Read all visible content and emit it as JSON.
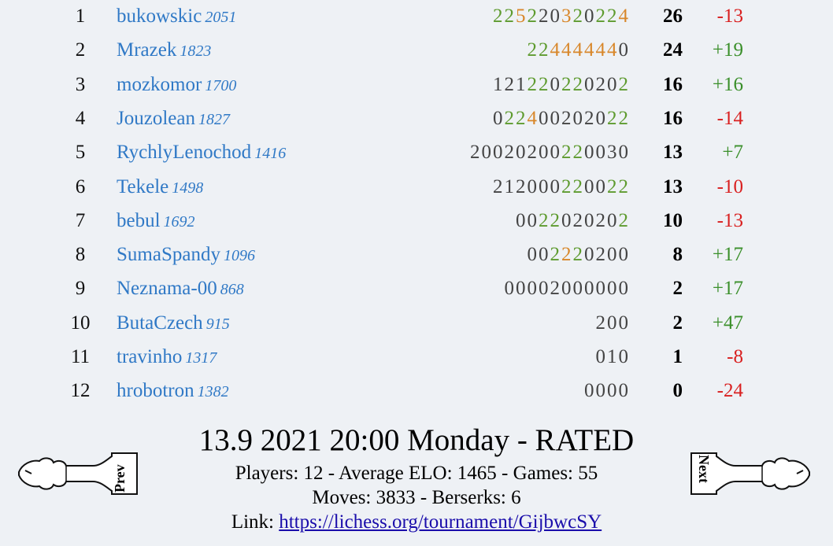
{
  "standings": [
    {
      "rank": "1",
      "name": "bukowskic",
      "elo": "2051",
      "scores": [
        {
          "t": "2",
          "c": "g"
        },
        {
          "t": "2",
          "c": "g"
        },
        {
          "t": "5",
          "c": "o"
        },
        {
          "t": "2",
          "c": "g"
        },
        {
          "t": "2",
          "c": "d"
        },
        {
          "t": "0",
          "c": "d"
        },
        {
          "t": "3",
          "c": "o"
        },
        {
          "t": "2",
          "c": "g"
        },
        {
          "t": "0",
          "c": "d"
        },
        {
          "t": "2",
          "c": "g"
        },
        {
          "t": "2",
          "c": "g"
        },
        {
          "t": "4",
          "c": "o"
        }
      ],
      "points": "26",
      "diff": "-13"
    },
    {
      "rank": "2",
      "name": "Mrazek",
      "elo": "1823",
      "scores": [
        {
          "t": "2",
          "c": "g"
        },
        {
          "t": "2",
          "c": "g"
        },
        {
          "t": "4",
          "c": "o"
        },
        {
          "t": "4",
          "c": "o"
        },
        {
          "t": "4",
          "c": "o"
        },
        {
          "t": "4",
          "c": "o"
        },
        {
          "t": "4",
          "c": "o"
        },
        {
          "t": "4",
          "c": "o"
        },
        {
          "t": "0",
          "c": "d"
        }
      ],
      "points": "24",
      "diff": "+19"
    },
    {
      "rank": "3",
      "name": "mozkomor",
      "elo": "1700",
      "scores": [
        {
          "t": "1",
          "c": "d"
        },
        {
          "t": "2",
          "c": "d"
        },
        {
          "t": "1",
          "c": "d"
        },
        {
          "t": "2",
          "c": "g"
        },
        {
          "t": "2",
          "c": "g"
        },
        {
          "t": "0",
          "c": "d"
        },
        {
          "t": "2",
          "c": "g"
        },
        {
          "t": "2",
          "c": "g"
        },
        {
          "t": "0",
          "c": "d"
        },
        {
          "t": "2",
          "c": "d"
        },
        {
          "t": "0",
          "c": "d"
        },
        {
          "t": "2",
          "c": "g"
        }
      ],
      "points": "16",
      "diff": "+16"
    },
    {
      "rank": "4",
      "name": "Jouzolean",
      "elo": "1827",
      "scores": [
        {
          "t": "0",
          "c": "d"
        },
        {
          "t": "2",
          "c": "g"
        },
        {
          "t": "2",
          "c": "g"
        },
        {
          "t": "4",
          "c": "o"
        },
        {
          "t": "0",
          "c": "d"
        },
        {
          "t": "0",
          "c": "d"
        },
        {
          "t": "2",
          "c": "d"
        },
        {
          "t": "0",
          "c": "d"
        },
        {
          "t": "2",
          "c": "d"
        },
        {
          "t": "0",
          "c": "d"
        },
        {
          "t": "2",
          "c": "g"
        },
        {
          "t": "2",
          "c": "g"
        }
      ],
      "points": "16",
      "diff": "-14"
    },
    {
      "rank": "5",
      "name": "RychlyLenochod",
      "elo": "1416",
      "scores": [
        {
          "t": "2",
          "c": "d"
        },
        {
          "t": "0",
          "c": "d"
        },
        {
          "t": "0",
          "c": "d"
        },
        {
          "t": "2",
          "c": "d"
        },
        {
          "t": "0",
          "c": "d"
        },
        {
          "t": "2",
          "c": "d"
        },
        {
          "t": "0",
          "c": "d"
        },
        {
          "t": "0",
          "c": "d"
        },
        {
          "t": "2",
          "c": "g"
        },
        {
          "t": "2",
          "c": "g"
        },
        {
          "t": "0",
          "c": "d"
        },
        {
          "t": "0",
          "c": "d"
        },
        {
          "t": "3",
          "c": "d"
        },
        {
          "t": "0",
          "c": "d"
        }
      ],
      "points": "13",
      "diff": "+7"
    },
    {
      "rank": "6",
      "name": "Tekele",
      "elo": "1498",
      "scores": [
        {
          "t": "2",
          "c": "d"
        },
        {
          "t": "1",
          "c": "d"
        },
        {
          "t": "2",
          "c": "d"
        },
        {
          "t": "0",
          "c": "d"
        },
        {
          "t": "0",
          "c": "d"
        },
        {
          "t": "0",
          "c": "d"
        },
        {
          "t": "2",
          "c": "g"
        },
        {
          "t": "2",
          "c": "g"
        },
        {
          "t": "0",
          "c": "d"
        },
        {
          "t": "0",
          "c": "d"
        },
        {
          "t": "2",
          "c": "g"
        },
        {
          "t": "2",
          "c": "g"
        }
      ],
      "points": "13",
      "diff": "-10"
    },
    {
      "rank": "7",
      "name": "bebul",
      "elo": "1692",
      "scores": [
        {
          "t": "0",
          "c": "d"
        },
        {
          "t": "0",
          "c": "d"
        },
        {
          "t": "2",
          "c": "g"
        },
        {
          "t": "2",
          "c": "g"
        },
        {
          "t": "0",
          "c": "d"
        },
        {
          "t": "2",
          "c": "d"
        },
        {
          "t": "0",
          "c": "d"
        },
        {
          "t": "2",
          "c": "d"
        },
        {
          "t": "0",
          "c": "d"
        },
        {
          "t": "2",
          "c": "g"
        }
      ],
      "points": "10",
      "diff": "-13"
    },
    {
      "rank": "8",
      "name": "SumaSpandy",
      "elo": "1096",
      "scores": [
        {
          "t": "0",
          "c": "d"
        },
        {
          "t": "0",
          "c": "d"
        },
        {
          "t": "2",
          "c": "g"
        },
        {
          "t": "2",
          "c": "o"
        },
        {
          "t": "2",
          "c": "g"
        },
        {
          "t": "0",
          "c": "d"
        },
        {
          "t": "2",
          "c": "d"
        },
        {
          "t": "0",
          "c": "d"
        },
        {
          "t": "0",
          "c": "d"
        }
      ],
      "points": "8",
      "diff": "+17"
    },
    {
      "rank": "9",
      "name": "Neznama-00",
      "elo": "868",
      "scores": [
        {
          "t": "0",
          "c": "d"
        },
        {
          "t": "0",
          "c": "d"
        },
        {
          "t": "0",
          "c": "d"
        },
        {
          "t": "0",
          "c": "d"
        },
        {
          "t": "2",
          "c": "d"
        },
        {
          "t": "0",
          "c": "d"
        },
        {
          "t": "0",
          "c": "d"
        },
        {
          "t": "0",
          "c": "d"
        },
        {
          "t": "0",
          "c": "d"
        },
        {
          "t": "0",
          "c": "d"
        },
        {
          "t": "0",
          "c": "d"
        }
      ],
      "points": "2",
      "diff": "+17"
    },
    {
      "rank": "10",
      "name": "ButaCzech",
      "elo": "915",
      "scores": [
        {
          "t": "2",
          "c": "d"
        },
        {
          "t": "0",
          "c": "d"
        },
        {
          "t": "0",
          "c": "d"
        }
      ],
      "points": "2",
      "diff": "+47"
    },
    {
      "rank": "11",
      "name": "travinho",
      "elo": "1317",
      "scores": [
        {
          "t": "0",
          "c": "d"
        },
        {
          "t": "1",
          "c": "d"
        },
        {
          "t": "0",
          "c": "d"
        }
      ],
      "points": "1",
      "diff": "-8"
    },
    {
      "rank": "12",
      "name": "hrobotron",
      "elo": "1382",
      "scores": [
        {
          "t": "0",
          "c": "d"
        },
        {
          "t": "0",
          "c": "d"
        },
        {
          "t": "0",
          "c": "d"
        },
        {
          "t": "0",
          "c": "d"
        }
      ],
      "points": "0",
      "diff": "-24"
    }
  ],
  "tournament": {
    "title": "13.9 2021 20:00 Monday - RATED",
    "stats_line": "Players: 12 - Average ELO: 1465 - Games: 55",
    "moves_line": "Moves: 3833 - Berserks: 6",
    "link_label": "Link: ",
    "link_text": "https://lichess.org/tournament/GijbwcSY"
  },
  "nav": {
    "prev_label": "Prev",
    "next_label": "Next",
    "prev_icon": "bishop-prev-icon",
    "next_icon": "bishop-next-icon"
  },
  "colors": {
    "background": "#eef1f5",
    "player_link": "#3079c6",
    "score_green": "#5e9b2f",
    "score_orange": "#d8872a",
    "positive": "#3a8f2a",
    "negative": "#d92020"
  }
}
